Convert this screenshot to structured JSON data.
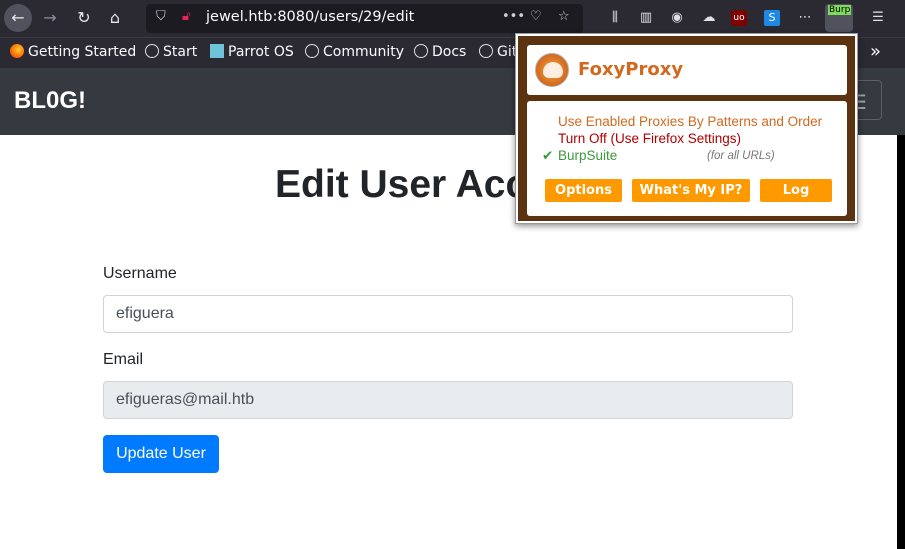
{
  "browser": {
    "url": "jewel.htb:8080/users/29/edit",
    "overflow_label": "»",
    "foxy_badge": "Burp",
    "bookmarks": [
      {
        "label": "Getting Started"
      },
      {
        "label": "Start"
      },
      {
        "label": "Parrot OS"
      },
      {
        "label": "Community"
      },
      {
        "label": "Docs"
      },
      {
        "label": "Git"
      }
    ]
  },
  "navbar": {
    "brand": "BL0G!"
  },
  "page": {
    "title": "Edit User Acc",
    "username_label": "Username",
    "username_value": "efiguera",
    "email_label": "Email",
    "email_value": "efigueras@mail.htb",
    "submit_label": "Update User"
  },
  "foxyproxy": {
    "title": "FoxyProxy",
    "mode_patterns": "Use Enabled Proxies By Patterns and Order",
    "mode_off": "Turn Off (Use Firefox Settings)",
    "selected_check": "✔",
    "proxy_name": "BurpSuite",
    "proxy_note": "(for all URLs)",
    "buttons": {
      "options": "Options",
      "whats_my_ip": "What's My IP?",
      "log": "Log"
    }
  },
  "colors": {
    "navbar_bg": "#343a40",
    "primary": "#007bff",
    "foxy_orange": "#ff9900",
    "foxy_brown": "#5c3310"
  }
}
